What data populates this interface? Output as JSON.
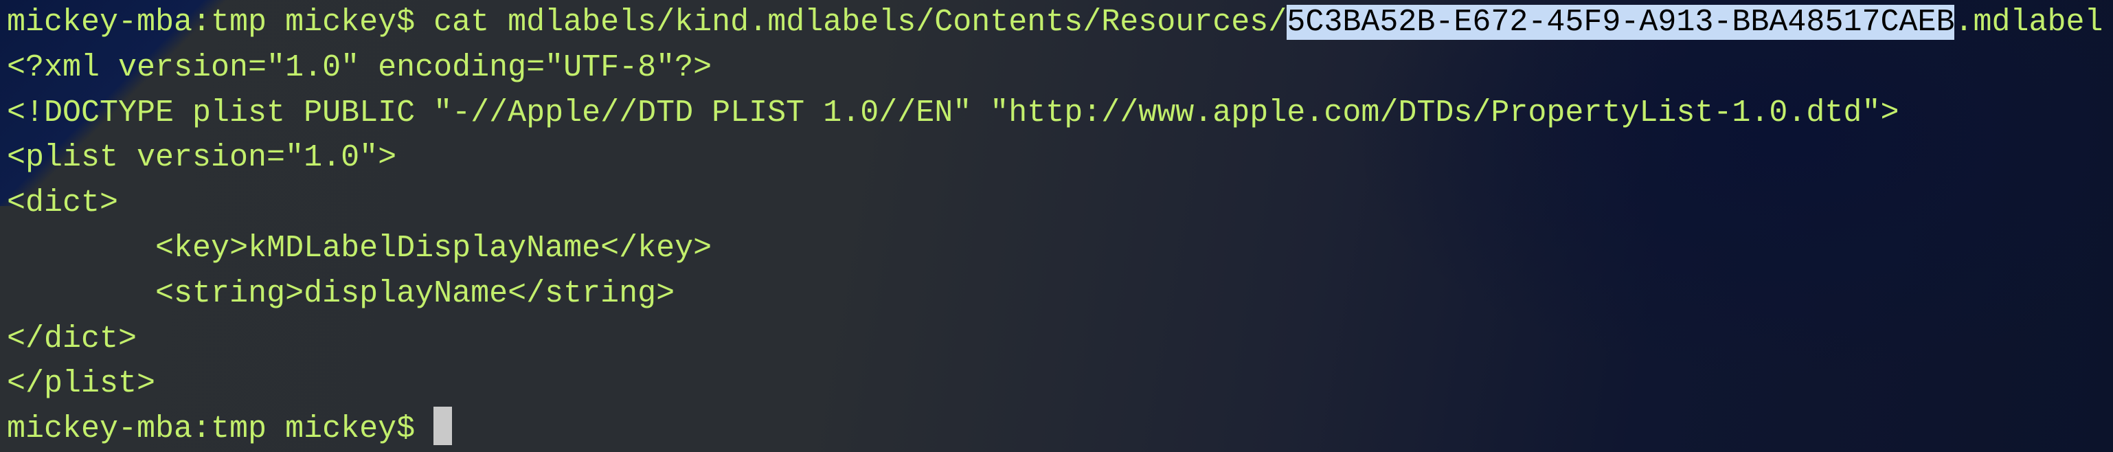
{
  "terminal": {
    "command": {
      "prompt": "mickey-mba:tmp mickey$ ",
      "cmd_prefix": "cat mdlabels/kind.mdlabels/Contents/Resources/",
      "selected_text": "5C3BA52B-E672-45F9-A913-BBA48517CAEB",
      "cmd_suffix": ".mdlabel"
    },
    "output_lines": [
      "<?xml version=\"1.0\" encoding=\"UTF-8\"?>",
      "<!DOCTYPE plist PUBLIC \"-//Apple//DTD PLIST 1.0//EN\" \"http://www.apple.com/DTDs/PropertyList-1.0.dtd\">",
      "<plist version=\"1.0\">",
      "<dict>",
      "\t<key>kMDLabelDisplayName</key>",
      "\t<string>displayName</string>",
      "</dict>",
      "</plist>"
    ],
    "final_prompt": "mickey-mba:tmp mickey$ ",
    "colors": {
      "text": "#c3ef6c",
      "selection": "#c6dbf6",
      "cursor": "#c9c9c9"
    }
  }
}
